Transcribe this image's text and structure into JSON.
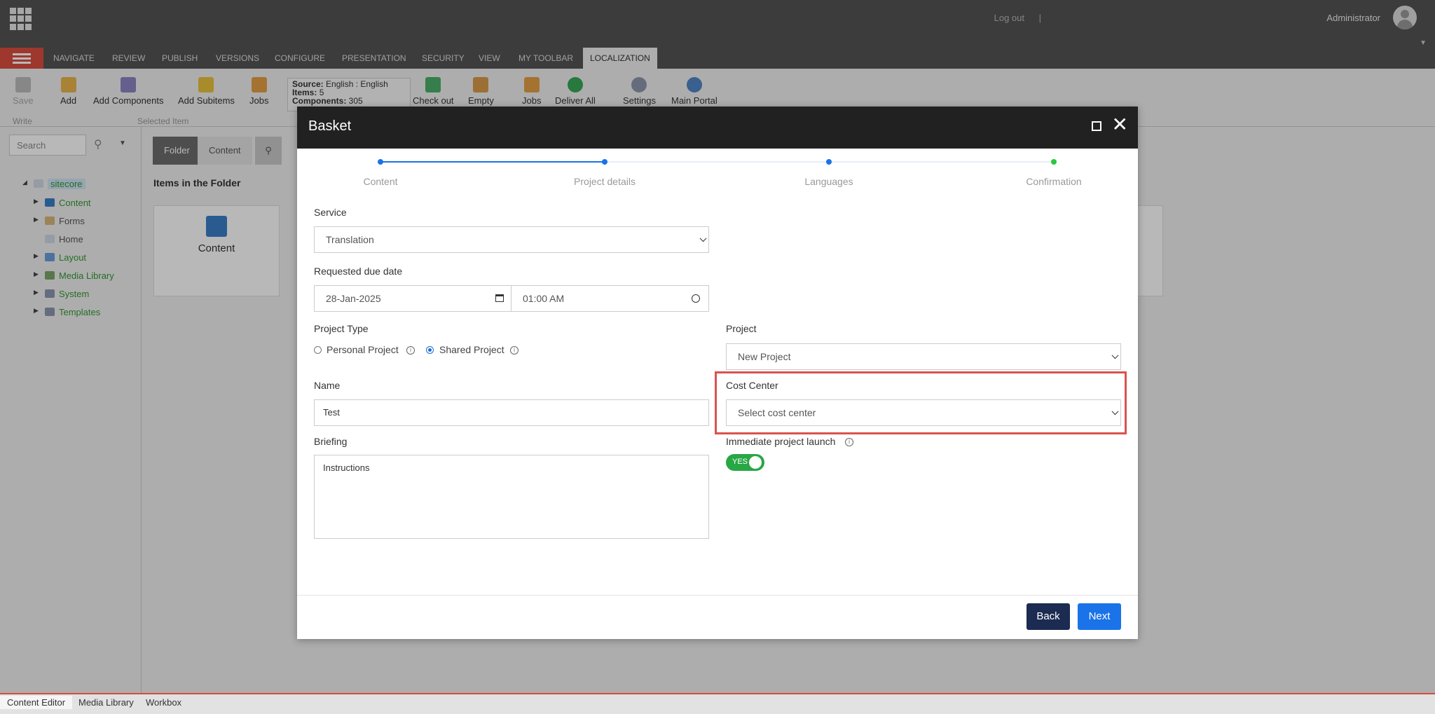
{
  "topbar": {
    "logout": "Log out",
    "separator": "|",
    "user": "Administrator"
  },
  "ribbon_tabs": [
    "NAVIGATE",
    "REVIEW",
    "PUBLISH",
    "VERSIONS",
    "CONFIGURE",
    "PRESENTATION",
    "SECURITY",
    "VIEW",
    "MY TOOLBAR",
    "LOCALIZATION"
  ],
  "ribbon": {
    "save": "Save",
    "write_group": "Write",
    "add": "Add",
    "add_components": "Add Components",
    "add_subitems": "Add Subitems",
    "jobs": "Jobs",
    "selected_item_group": "Selected Item",
    "source_label": "Source:",
    "source_value": "English : English",
    "items_label": "Items:",
    "items_value": "5",
    "components_label": "Components:",
    "components_value": "305",
    "check_out": "Check out",
    "empty": "Empty",
    "jobs2": "Jobs",
    "deliver_all": "Deliver All",
    "settings": "Settings",
    "main_portal": "Main Portal"
  },
  "left": {
    "search_placeholder": "Search",
    "tree": [
      "sitecore",
      "Content",
      "Forms",
      "Home",
      "Layout",
      "Media Library",
      "System",
      "Templates"
    ]
  },
  "content": {
    "tabs": [
      "Folder",
      "Content"
    ],
    "items_heading": "Items in the Folder",
    "item_label": "Content"
  },
  "bottom_tabs": [
    "Content Editor",
    "Media Library",
    "Workbox"
  ],
  "modal": {
    "title": "Basket",
    "steps": [
      "Content",
      "Project details",
      "Languages",
      "Confirmation"
    ],
    "service_label": "Service",
    "service_value": "Translation",
    "due_label": "Requested due date",
    "due_date": "28-Jan-2025",
    "due_time": "01:00 AM",
    "project_type_label": "Project Type",
    "personal": "Personal Project",
    "shared": "Shared Project",
    "project_label": "Project",
    "project_value": "New Project",
    "name_label": "Name",
    "name_value": "Test",
    "cost_center_label": "Cost Center",
    "cost_center_placeholder": "Select cost center",
    "briefing_label": "Briefing",
    "briefing_value": "Instructions",
    "launch_label": "Immediate project launch",
    "toggle_text": "YES",
    "back": "Back",
    "next": "Next"
  },
  "colors": {
    "accent": "#1a73e8",
    "dark": "#1b2b52",
    "toggle": "#28a745",
    "highlight": "#d9534f"
  }
}
